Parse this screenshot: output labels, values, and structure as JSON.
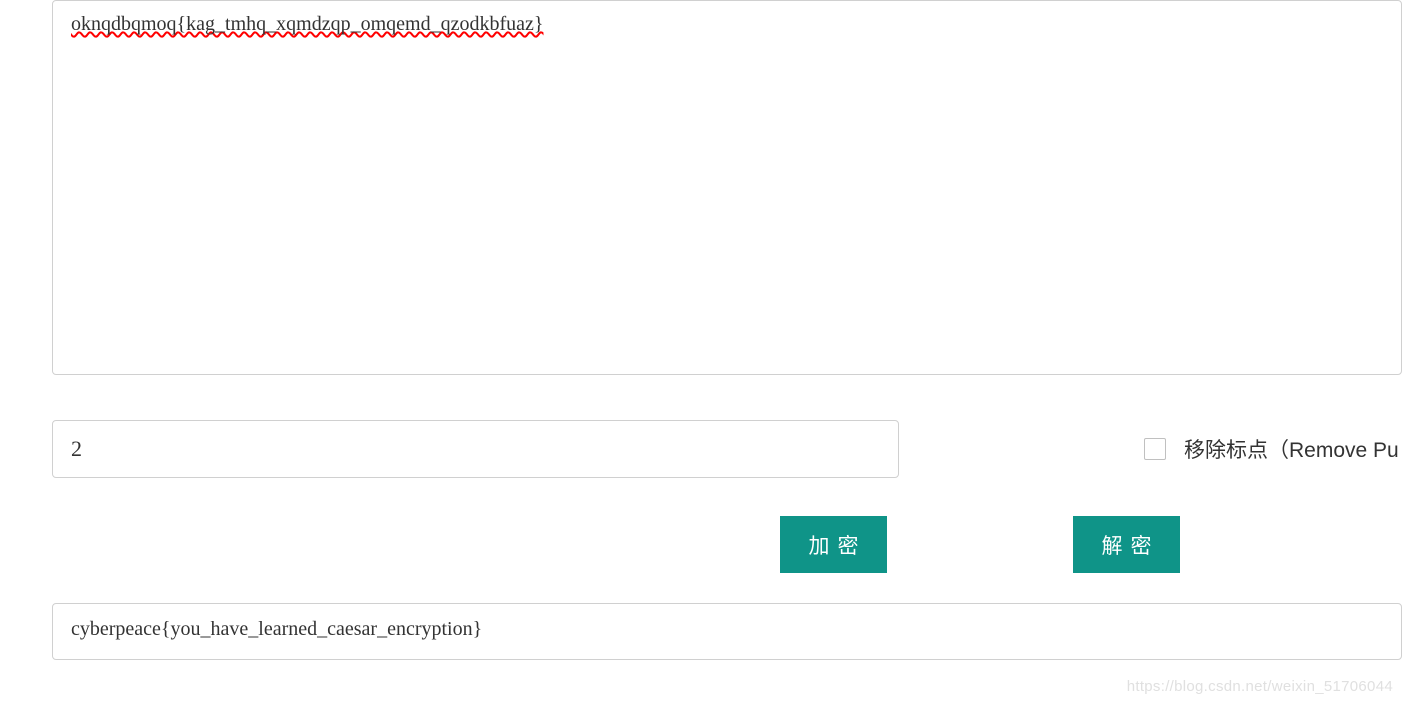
{
  "input": {
    "ciphertext": "oknqdbqmoq{kag_tmhq_xqmdzqp_omqemd_qzodkbfuaz}"
  },
  "shift": {
    "value": "2"
  },
  "options": {
    "remove_punctuation_label": "移除标点（Remove Pu"
  },
  "buttons": {
    "encrypt_label": "加密",
    "decrypt_label": "解密"
  },
  "output": {
    "plaintext": "cyberpeace{you_have_learned_caesar_encryption}"
  },
  "watermark": "https://blog.csdn.net/weixin_51706044"
}
